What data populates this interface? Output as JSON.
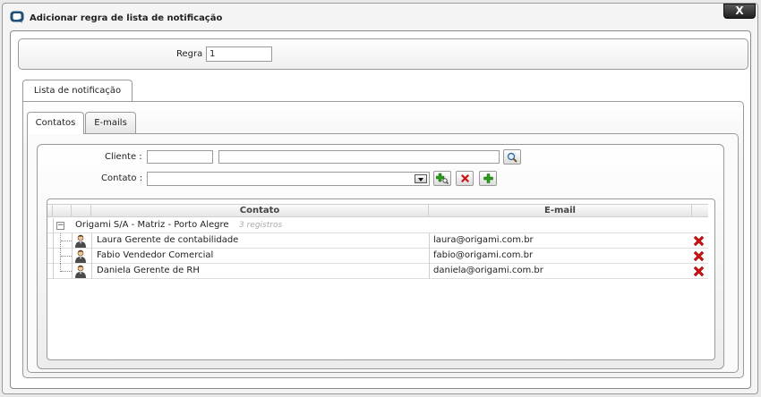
{
  "window": {
    "title": "Adicionar regra de lista de notificação",
    "close_label": "X",
    "icon": "app-logo-icon"
  },
  "regra": {
    "label": "Regra",
    "value": "1"
  },
  "tabs_outer": [
    {
      "label": "Lista de notificação"
    }
  ],
  "tabs_inner": [
    {
      "label": "Contatos"
    },
    {
      "label": "E-mails"
    }
  ],
  "form": {
    "cliente_label": "Cliente :",
    "contato_label": "Contato :"
  },
  "grid": {
    "columns": [
      "Contato",
      "E-mail"
    ],
    "group": {
      "name": "Origami S/A - Matriz - Porto Alegre",
      "count": "3 registros"
    },
    "rows": [
      {
        "contato": "Laura Gerente de contabilidade",
        "email": "laura@origami.com.br"
      },
      {
        "contato": "Fabio Vendedor Comercial",
        "email": "fabio@origami.com.br"
      },
      {
        "contato": "Daniela Gerente de RH",
        "email": "daniela@origami.com.br"
      }
    ]
  },
  "colors": {
    "accent": "#1f4f7a",
    "delete": "#cc1111",
    "add": "#2a9a1a"
  }
}
